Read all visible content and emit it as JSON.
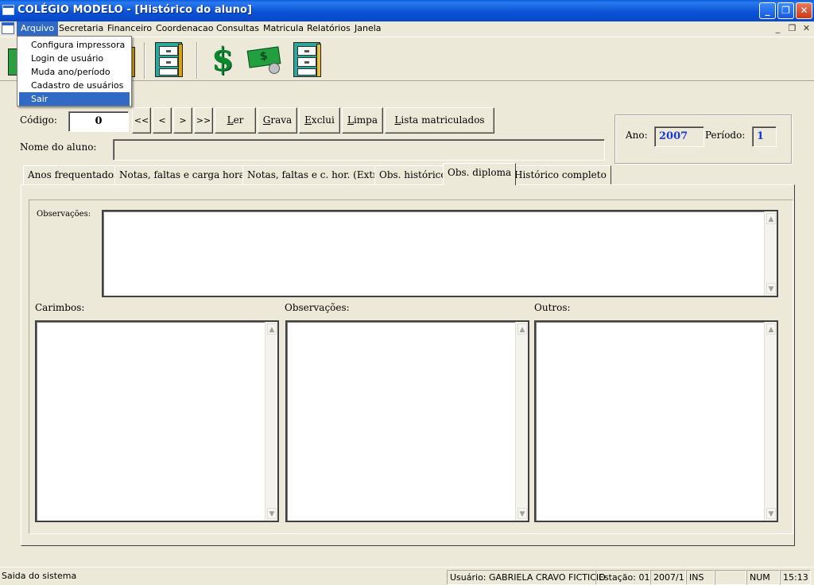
{
  "window": {
    "title": "COLÉGIO MODELO - [Histórico do aluno]",
    "min_symbol": "_",
    "max_symbol": "❐",
    "close_symbol": "✕"
  },
  "menubar": {
    "items": [
      "Arquivo",
      "Secretaria",
      "Financeiro",
      "Coordenacao",
      "Consultas",
      "Matricula",
      "Relatórios",
      "Janela"
    ],
    "active": "Arquivo",
    "mdi_controls": [
      "_",
      "❐",
      "✕"
    ]
  },
  "dropdown": {
    "items": [
      "Configura impressora",
      "Login de usuário",
      "Muda ano/período",
      "Cadastro de usuários",
      "Sair"
    ],
    "selected": "Sair"
  },
  "toolbar": {
    "icons": [
      "file-cabinet-icon",
      "dollar-icon",
      "money-icon",
      "file-cabinet-open-icon"
    ],
    "dollar_glyph": "$"
  },
  "form": {
    "codigo_label": "Código:",
    "codigo_value": "0",
    "nav_buttons": [
      "<<",
      "<",
      ">",
      ">>"
    ],
    "action_buttons": [
      "Ler",
      "Grava",
      "Exclui",
      "Limpa",
      "Lista matriculados"
    ],
    "nome_label": "Nome do aluno:",
    "nome_value": "",
    "ano_label": "Ano:",
    "ano_value": "2007",
    "periodo_label": "Período:",
    "periodo_value": "1"
  },
  "tabs": {
    "items": [
      "Anos frequentados",
      "Notas, faltas e carga horaria",
      "Notas, faltas e c. hor. (Extras)",
      "Obs. histórico",
      "Obs. diploma",
      "Histórico completo"
    ],
    "active": "Obs. diploma"
  },
  "panel": {
    "observacoes_top_label": "Observações:",
    "carimbos_label": "Carimbos:",
    "observacoes_label": "Observações:",
    "outros_label": "Outros:"
  },
  "statusbar": {
    "message": "Saida do sistema",
    "usuario": "Usuário: GABRIELA CRAVO FICTICIO",
    "estacao": "Estação: 01",
    "periodo": "2007/1",
    "ins": "INS",
    "blank": "",
    "num": "NUM",
    "time": "15:13"
  },
  "colors": {
    "titlebar": "#0a52d6",
    "menu_highlight": "#316ac5",
    "window_bg": "#ece9d8",
    "accent_value": "#1a3ad8"
  }
}
